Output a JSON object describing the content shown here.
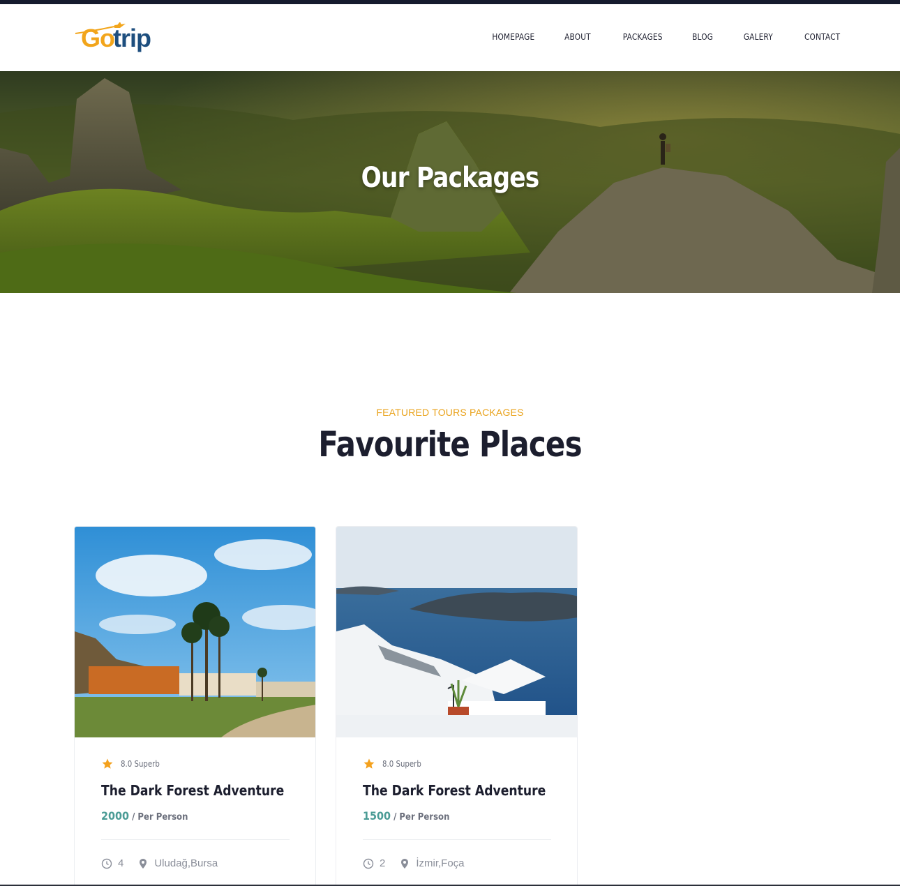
{
  "brand": {
    "logo_part1": "Go",
    "logo_part2": "trip",
    "primary": "#1d4e7e",
    "accent": "#f2a51b"
  },
  "nav": {
    "items": [
      {
        "label": "HOMEPAGE"
      },
      {
        "label": "ABOUT"
      },
      {
        "label": "PACKAGES"
      },
      {
        "label": "BLOG"
      },
      {
        "label": "GALERY"
      },
      {
        "label": "CONTACT"
      }
    ]
  },
  "hero": {
    "title": "Our Packages"
  },
  "section": {
    "kicker": "FEATURED TOURS PACKAGES",
    "title": "Favourite Places"
  },
  "cards": [
    {
      "rating": "8.0 Superb",
      "title": "The Dark Forest Adventure",
      "price": "2000",
      "per": "/ Per Person",
      "days": "4",
      "location": "Uludağ,Bursa",
      "image_icon": "palm-resort-photo"
    },
    {
      "rating": "8.0 Superb",
      "title": "The Dark Forest Adventure",
      "price": "1500",
      "per": "/ Per Person",
      "days": "2",
      "location": "İzmir,Foça",
      "image_icon": "sea-terrace-photo"
    }
  ],
  "colors": {
    "star": "#f4a11d",
    "price": "#4a9b95",
    "kicker": "#e9a21a",
    "dark": "#1c1e2e"
  }
}
